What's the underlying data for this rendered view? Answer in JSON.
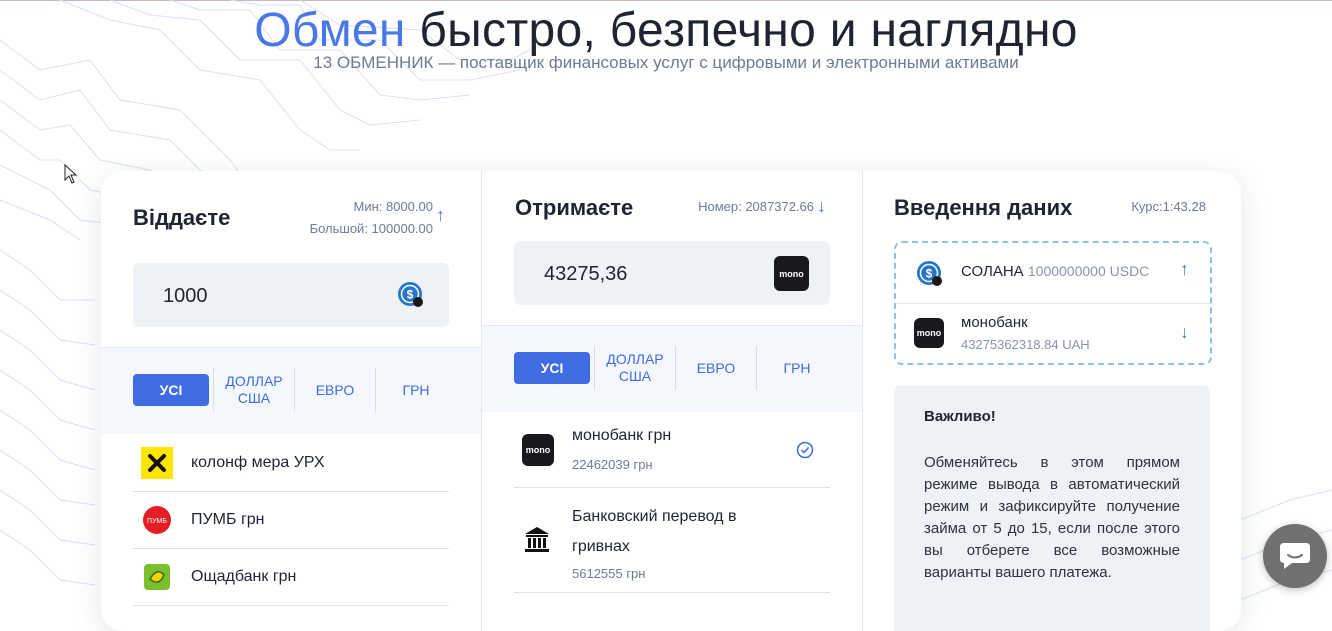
{
  "hero": {
    "title_accent": "Обмен",
    "title_rest": " быстро, безпечно и наглядно",
    "subtitle": "13 ОБМЕННИК — поставщик финансовых услуг с цифровыми и электронными активами"
  },
  "give": {
    "title": "Віддаєте",
    "min_label": "Мин: 8000.00",
    "max_label": "Большой: 100000.00",
    "amount": "1000",
    "icon": "usdc-coin-icon",
    "filters": [
      "УСІ",
      "ДОЛЛАР США",
      "ЕВРО",
      "ГРН"
    ],
    "active_filter": "УСІ",
    "banks": [
      {
        "name": "колонф мера УРХ",
        "icon": "raiffeisen-icon"
      },
      {
        "name": "ПУМБ грн",
        "icon": "pumb-icon"
      },
      {
        "name": "Ощадбанк грн",
        "icon": "oschadbank-icon"
      }
    ]
  },
  "receive": {
    "title": "Отримаєте",
    "reserve_label": "Номер: 2087372.66",
    "amount": "43275,36",
    "icon_text": "mono",
    "filters": [
      "УСІ",
      "ДОЛЛАР США",
      "ЕВРО",
      "ГРН"
    ],
    "active_filter": "УСІ",
    "banks": [
      {
        "name": "монобанк грн",
        "reserve": "22462039 грн",
        "icon_text": "mono",
        "selected": true
      },
      {
        "name": "Банковский перевод в гривнах",
        "reserve": "5612555 грн",
        "icon": "bank-building-icon",
        "selected": false
      }
    ]
  },
  "details": {
    "title": "Введення даних",
    "rate": "Курс:1:43.28",
    "from": {
      "name": "СОЛАНА",
      "amount": "1000000000 USDC"
    },
    "to": {
      "name": "монобанк",
      "amount": "43275362318.84 UAH",
      "icon_text": "mono"
    },
    "notice_title": "Важливо!",
    "notice_text": "Обменяйтесь в этом прямом режиме вывода в автоматический режим и зафиксируйте получение займа от 5 до 15, если после этого вы отберете все возможные варианты вашего платежа."
  },
  "colors": {
    "accent": "#4a78e6",
    "active_tab": "#3f6ce0",
    "dark_icon": "#17191c",
    "dashed_border": "#8ec0ec"
  },
  "chat": {
    "icon": "chat-bubble-icon"
  }
}
